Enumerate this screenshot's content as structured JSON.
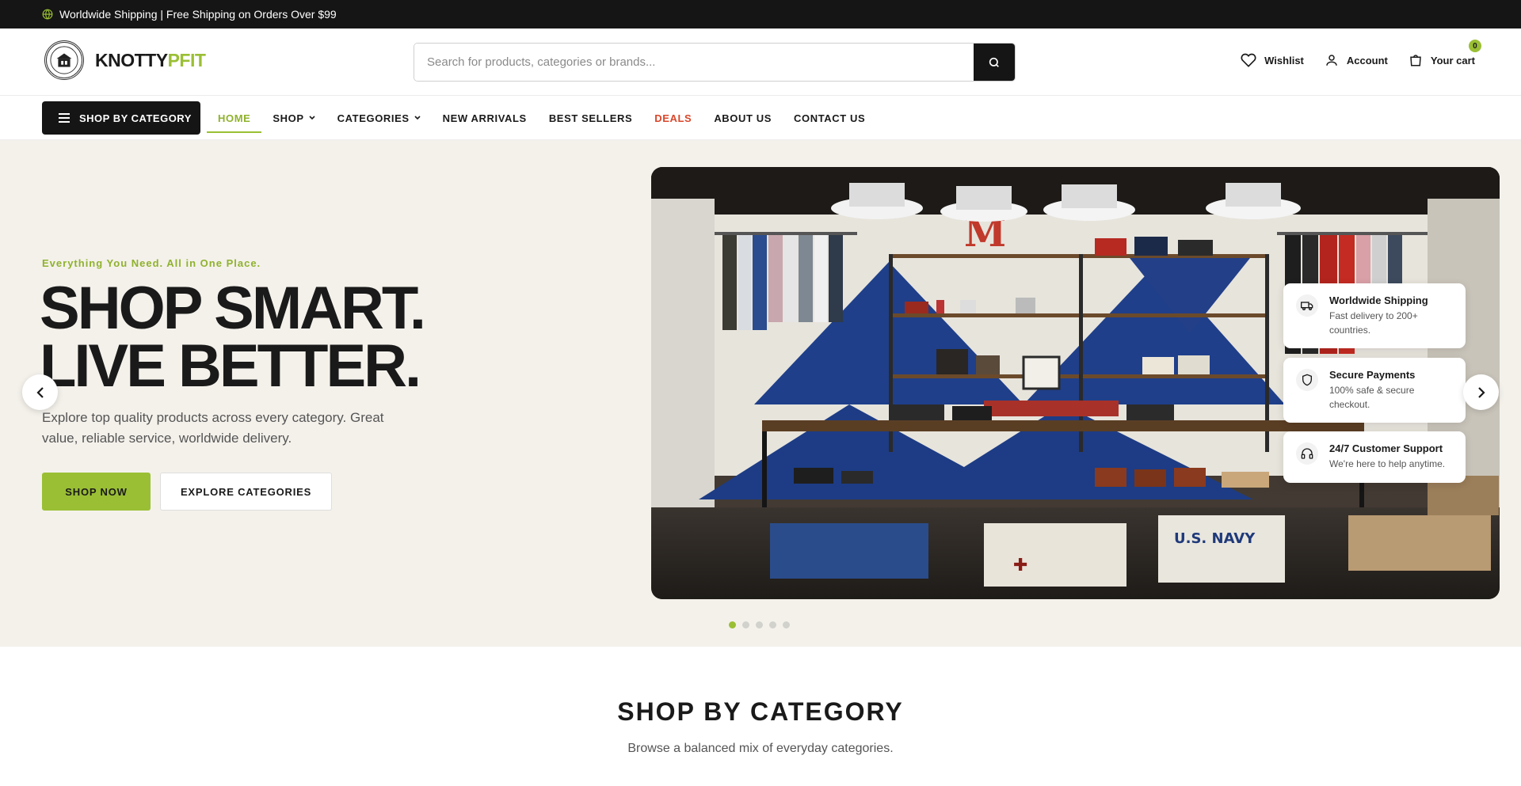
{
  "topbar": {
    "text": "Worldwide Shipping | Free Shipping on Orders Over $99"
  },
  "header": {
    "logo": {
      "part1": "KNOTTY",
      "part2": "PFIT"
    },
    "search": {
      "placeholder": "Search for products, categories or brands..."
    },
    "wishlist_label": "Wishlist",
    "account_label": "Account",
    "cart_label": "Your cart",
    "cart_count": "0"
  },
  "nav": {
    "category_button": "SHOP BY CATEGORY",
    "links": [
      "HOME",
      "SHOP",
      "CATEGORIES",
      "NEW ARRIVALS",
      "BEST SELLERS",
      "DEALS",
      "ABOUT US",
      "CONTACT US"
    ]
  },
  "hero": {
    "eyebrow": "Everything You Need. All in One Place.",
    "headline_line1": "SHOP SMART.",
    "headline_line2": "LIVE BETTER.",
    "subtext": "Explore top quality products across every category. Great value, reliable service, worldwide delivery.",
    "primary_cta": "SHOP NOW",
    "secondary_cta": "EXPLORE CATEGORIES",
    "features": [
      {
        "title": "Worldwide Shipping",
        "desc": "Fast delivery to 200+ countries.",
        "icon": "truck-icon"
      },
      {
        "title": "Secure Payments",
        "desc": "100% safe & secure checkout.",
        "icon": "shield-icon"
      },
      {
        "title": "24/7 Customer Support",
        "desc": "We're here to help anytime.",
        "icon": "headset-icon"
      }
    ],
    "slides_total": 5,
    "active_slide": 1
  },
  "shop_by_category": {
    "title": "SHOP BY CATEGORY",
    "subtitle": "Browse a balanced mix of everyday categories."
  },
  "colors": {
    "accent": "#9abf34",
    "dark": "#151515",
    "hero_bg": "#f4f1eb",
    "deal": "#d9472b"
  }
}
